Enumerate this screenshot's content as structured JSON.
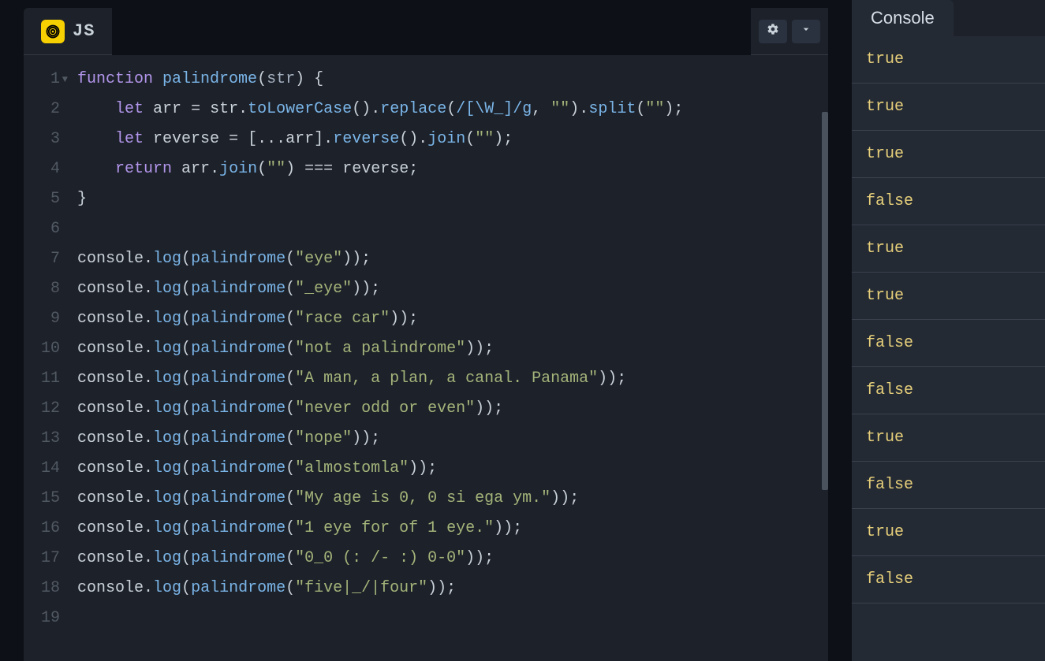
{
  "editor": {
    "language": "JS",
    "lineNumbers": [
      "1",
      "2",
      "3",
      "4",
      "5",
      "6",
      "7",
      "8",
      "9",
      "10",
      "11",
      "12",
      "13",
      "14",
      "15",
      "16",
      "17",
      "18",
      "19"
    ],
    "code": {
      "line1": {
        "kw": "function",
        "fn": "palindrome",
        "paren_open": "(",
        "param": "str",
        "paren_close": ")",
        "brace": "{"
      },
      "line2": {
        "indent": "    ",
        "kw": "let",
        "ident": "arr",
        "eq": "=",
        "param": "str",
        "dot1": ".",
        "m1": "toLowerCase",
        "p1": "()",
        "dot2": ".",
        "m2": "replace",
        "p2o": "(",
        "regex": "/[\\W_]/g",
        "comma": ", ",
        "str1": "\"\"",
        "p2c": ")",
        "dot3": ".",
        "m3": "split",
        "p3o": "(",
        "str2": "\"\"",
        "p3c": ");"
      },
      "line3": {
        "indent": "    ",
        "kw": "let",
        "ident": "reverse",
        "eq": "=",
        "br": "[",
        "spread": "...",
        "param": "arr",
        "brc": "]",
        "dot1": ".",
        "m1": "reverse",
        "p1": "()",
        "dot2": ".",
        "m2": "join",
        "p2o": "(",
        "str": "\"\"",
        "p2c": ");"
      },
      "line4": {
        "indent": "    ",
        "kw": "return",
        "ident": "arr",
        "dot": ".",
        "m": "join",
        "po": "(",
        "str": "\"\"",
        "pc": ")",
        "oper": "===",
        "r": "reverse",
        "semi": ";"
      },
      "line5": {
        "brace": "}"
      },
      "calls": [
        {
          "arg": "\"eye\""
        },
        {
          "arg": "\"_eye\""
        },
        {
          "arg": "\"race car\""
        },
        {
          "arg": "\"not a palindrome\""
        },
        {
          "arg": "\"A man, a plan, a canal. Panama\""
        },
        {
          "arg": "\"never odd or even\""
        },
        {
          "arg": "\"nope\""
        },
        {
          "arg": "\"almostomla\""
        },
        {
          "arg": "\"My age is 0, 0 si ega ym.\""
        },
        {
          "arg": "\"1 eye for of 1 eye.\""
        },
        {
          "arg": "\"0_0 (: /- :) 0-0\""
        },
        {
          "arg": "\"five|_/|four\""
        }
      ],
      "call_template": {
        "obj": "console",
        "dot": ".",
        "method": "log",
        "po": "(",
        "fn": "palindrome",
        "pio": "(",
        "pic": ")",
        "pc": ");"
      }
    }
  },
  "console": {
    "title": "Console",
    "rows": [
      "true",
      "true",
      "true",
      "false",
      "true",
      "true",
      "false",
      "false",
      "true",
      "false",
      "true",
      "false"
    ]
  },
  "icons": {
    "gear": "gear-icon",
    "chevron_down": "chevron-down-icon",
    "js_logo": "js-logo-icon"
  }
}
